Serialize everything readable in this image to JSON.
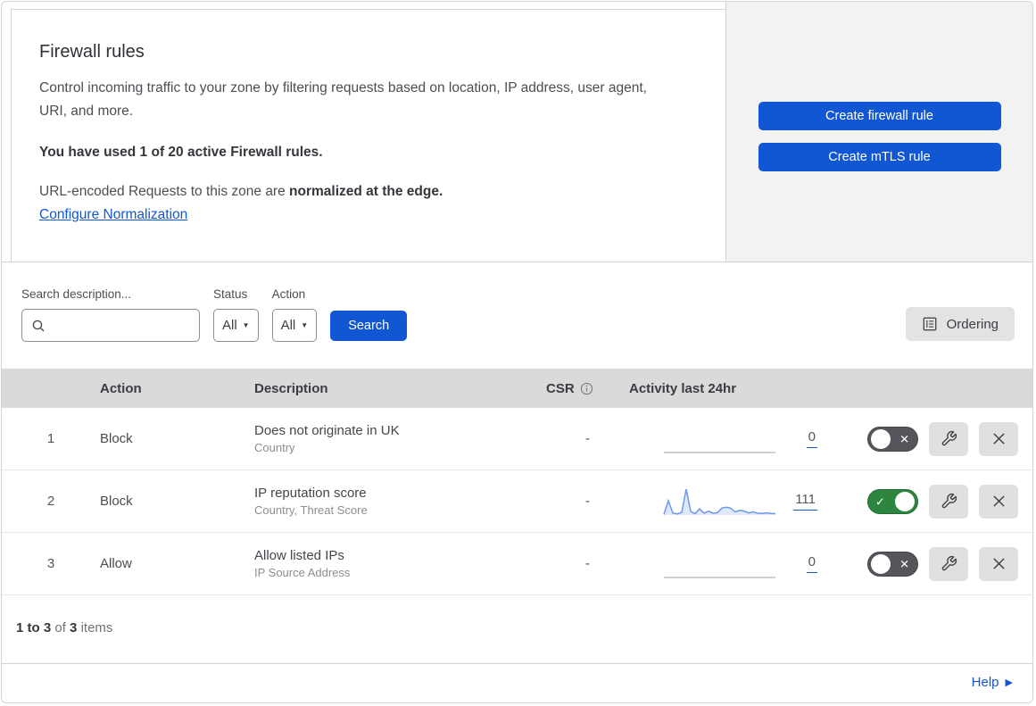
{
  "colors": {
    "primary_blue": "#1156d2",
    "toggle_on_green": "#2e8540",
    "toggle_off_gray": "#55565b",
    "side_panel_gray": "#f2f2f2",
    "table_header_gray": "#dadada",
    "spark_line_blue": "#6d99e8",
    "spark_fill_blue": "#dfe9f9"
  },
  "icons": {
    "caret": "▼",
    "toggle_on_check": "✓",
    "toggle_off_cross": "✕",
    "help_arrow": "▶"
  },
  "header": {
    "title": "Firewall rules",
    "description": "Control incoming traffic to your zone by filtering requests based on location, IP address, user agent, URI, and more.",
    "usage_note": "You have used 1 of 20 active Firewall rules.",
    "norm_prefix": "URL-encoded Requests to this zone are ",
    "norm_bold": "normalized at the edge.",
    "norm_link": "Configure Normalization",
    "buttons": [
      {
        "label": "Create firewall rule"
      },
      {
        "label": "Create mTLS rule"
      }
    ]
  },
  "filters": {
    "search_label": "Search description...",
    "status_label": "Status",
    "status_value": "All",
    "action_label": "Action",
    "action_value": "All",
    "search_button": "Search",
    "ordering_button": "Ordering"
  },
  "table": {
    "columns": {
      "action": "Action",
      "description": "Description",
      "csr": "CSR",
      "activity": "Activity last 24hr"
    },
    "rows": [
      {
        "priority": "1",
        "action": "Block",
        "description": "Does not originate in UK",
        "criteria": "Country",
        "csr": "-",
        "activity_count": "0",
        "enabled": false,
        "spark": [
          0,
          0
        ]
      },
      {
        "priority": "2",
        "action": "Block",
        "description": "IP reputation score",
        "criteria": "Country, Threat Score",
        "csr": "-",
        "activity_count": "111",
        "enabled": true,
        "spark": [
          2,
          55,
          8,
          4,
          10,
          100,
          14,
          5,
          24,
          7,
          15,
          7,
          9,
          27,
          30,
          26,
          12,
          18,
          15,
          8,
          12,
          7,
          6,
          8,
          6,
          5
        ]
      },
      {
        "priority": "3",
        "action": "Allow",
        "description": "Allow listed IPs",
        "criteria": "IP Source Address",
        "csr": "-",
        "activity_count": "0",
        "enabled": false,
        "spark": [
          0,
          0
        ]
      }
    ]
  },
  "footer": {
    "range": "1 to 3",
    "of": "of",
    "total": "3",
    "items": "items"
  },
  "help": {
    "label": "Help"
  }
}
